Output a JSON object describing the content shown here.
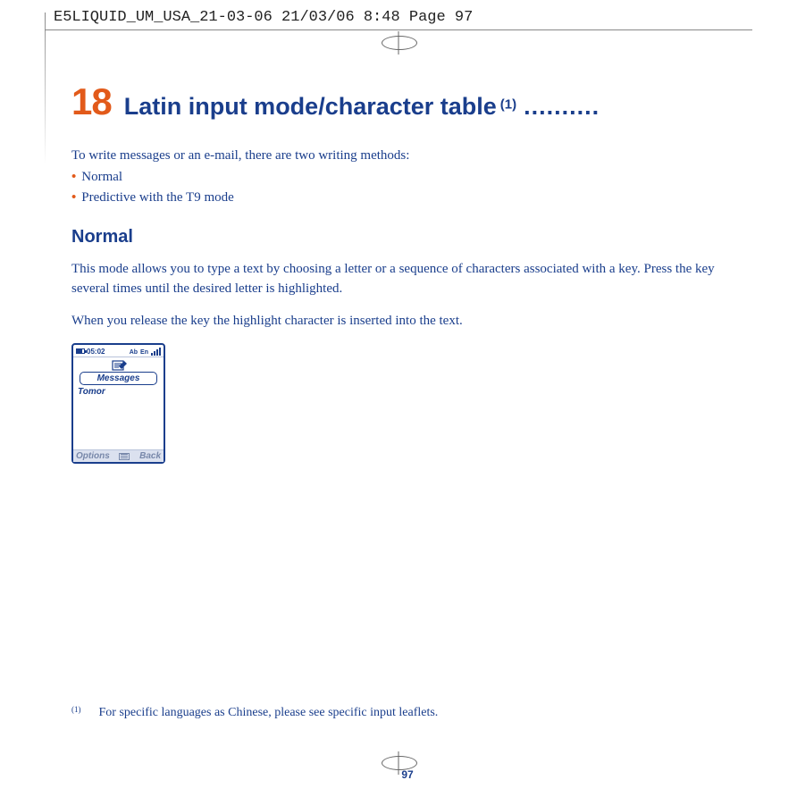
{
  "print_header": "E5LIQUID_UM_USA_21-03-06  21/03/06  8:48  Page 97",
  "chapter": {
    "number": "18",
    "title": "Latin input mode/character table",
    "sup": "(1)",
    "dots": ".........."
  },
  "intro": "To write messages or an e-mail, there are two writing methods:",
  "bullets": [
    "Normal",
    "Predictive with the T9 mode"
  ],
  "section_heading": "Normal",
  "para1": "This mode allows you to type a text by choosing a letter or a sequence of characters associated with a key. Press the key several times until the desired letter is highlighted.",
  "para2": "When you release the key the highlight character is inserted into the text.",
  "phone": {
    "time": "05:02",
    "ab": "Ab",
    "tab": "Messages",
    "typed": "Tomor",
    "soft_left": "Options",
    "soft_right": "Back"
  },
  "footnote": {
    "mark": "(1)",
    "text": "For specific languages as Chinese, please see specific input leaflets."
  },
  "page_number": "97"
}
